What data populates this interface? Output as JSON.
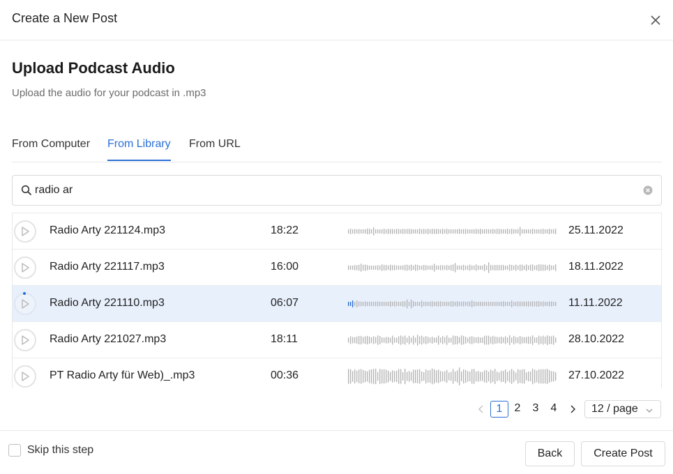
{
  "header": {
    "title": "Create a New Post"
  },
  "section": {
    "title": "Upload Podcast Audio",
    "subtitle": "Upload the audio for your podcast in .mp3"
  },
  "tabs": [
    {
      "label": "From Computer",
      "active": false
    },
    {
      "label": "From Library",
      "active": true
    },
    {
      "label": "From URL",
      "active": false
    }
  ],
  "search": {
    "value": "radio ar",
    "placeholder": ""
  },
  "files": [
    {
      "name": "Radio Arty 221124.mp3",
      "duration": "18:22",
      "date": "25.11.2022",
      "selected": false
    },
    {
      "name": "Radio Arty 221117.mp3",
      "duration": "16:00",
      "date": "18.11.2022",
      "selected": false
    },
    {
      "name": "Radio Arty 221110.mp3",
      "duration": "06:07",
      "date": "11.11.2022",
      "selected": true
    },
    {
      "name": "Radio Arty 221027.mp3",
      "duration": "18:11",
      "date": "28.10.2022",
      "selected": false
    },
    {
      "name": "PT Radio Arty für Web)_.mp3",
      "duration": "00:36",
      "date": "27.10.2022",
      "selected": false
    }
  ],
  "pagination": {
    "pages": [
      "1",
      "2",
      "3",
      "4"
    ],
    "current": "1",
    "page_size": "12 / page"
  },
  "footer": {
    "skip_label": "Skip this step",
    "back_label": "Back",
    "create_label": "Create Post"
  },
  "colors": {
    "accent": "#2b6fd6",
    "selected_row": "#e8f0fc",
    "waveform": "#b5b5b5"
  },
  "icons": [
    "close-icon",
    "search-icon",
    "clear-icon",
    "play-icon",
    "chevron-left-icon",
    "chevron-right-icon",
    "chevron-down-icon"
  ]
}
